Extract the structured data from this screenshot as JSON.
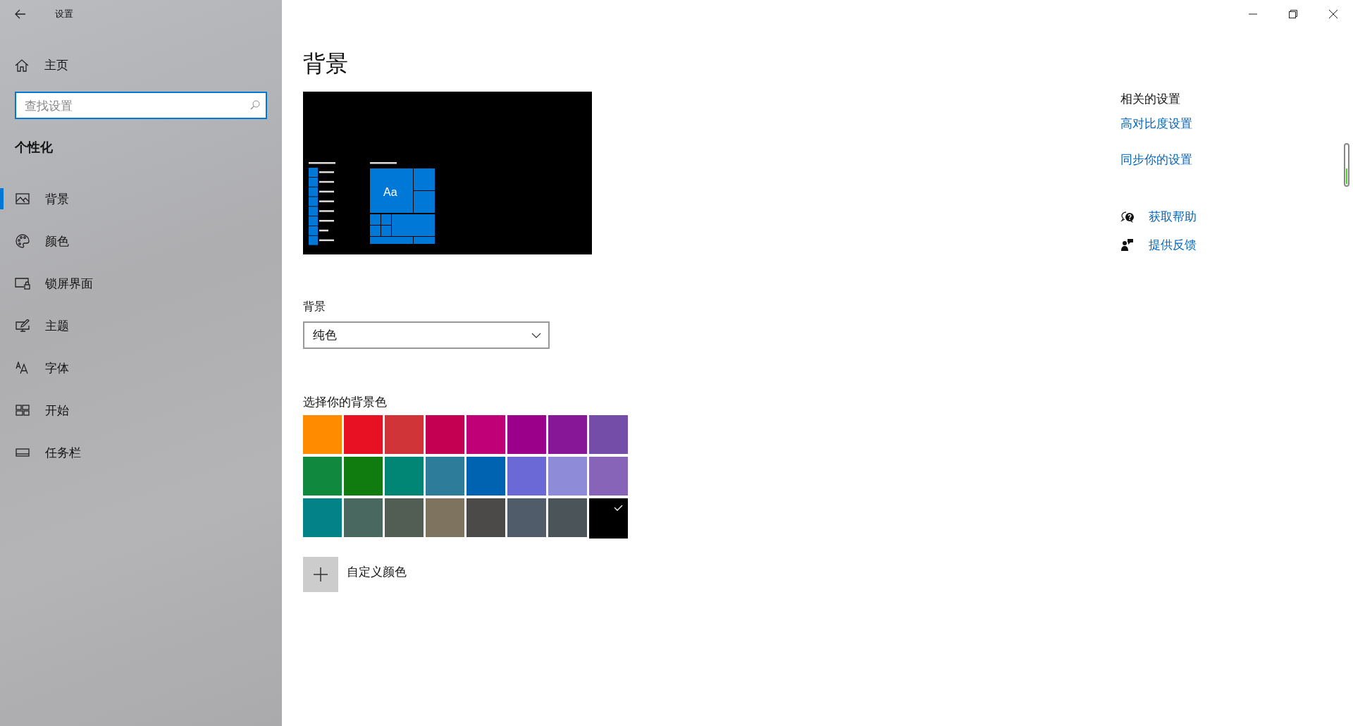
{
  "window": {
    "title": "设置"
  },
  "sidebar": {
    "home": "主页",
    "search": {
      "placeholder": "查找设置"
    },
    "section": "个性化",
    "items": [
      {
        "label": "背景",
        "kind": "picture",
        "selected": true
      },
      {
        "label": "颜色",
        "kind": "palette",
        "selected": false
      },
      {
        "label": "锁屏界面",
        "kind": "lock",
        "selected": false
      },
      {
        "label": "主题",
        "kind": "theme",
        "selected": false
      },
      {
        "label": "字体",
        "kind": "font",
        "selected": false
      },
      {
        "label": "开始",
        "kind": "start",
        "selected": false
      },
      {
        "label": "任务栏",
        "kind": "taskbar",
        "selected": false
      }
    ]
  },
  "page": {
    "title": "背景",
    "preview": {
      "tile_text": "Aa"
    },
    "background": {
      "label": "背景",
      "value": "纯色"
    },
    "colors_label": "选择你的背景色",
    "colors": [
      {
        "color": "#ff8c00",
        "selected": false
      },
      {
        "color": "#e81123",
        "selected": false
      },
      {
        "color": "#d13438",
        "selected": false
      },
      {
        "color": "#c30052",
        "selected": false
      },
      {
        "color": "#bf0077",
        "selected": false
      },
      {
        "color": "#9a0089",
        "selected": false
      },
      {
        "color": "#881798",
        "selected": false
      },
      {
        "color": "#744da9",
        "selected": false
      },
      {
        "color": "#10893e",
        "selected": false
      },
      {
        "color": "#107c10",
        "selected": false
      },
      {
        "color": "#018574",
        "selected": false
      },
      {
        "color": "#2d7d9a",
        "selected": false
      },
      {
        "color": "#0063b1",
        "selected": false
      },
      {
        "color": "#6b69d6",
        "selected": false
      },
      {
        "color": "#8e8cd8",
        "selected": false
      },
      {
        "color": "#8764b8",
        "selected": false
      },
      {
        "color": "#038387",
        "selected": false
      },
      {
        "color": "#486860",
        "selected": false
      },
      {
        "color": "#525e54",
        "selected": false
      },
      {
        "color": "#7e735f",
        "selected": false
      },
      {
        "color": "#4c4a48",
        "selected": false
      },
      {
        "color": "#515c6b",
        "selected": false
      },
      {
        "color": "#4a5459",
        "selected": false
      },
      {
        "color": "#000000",
        "selected": true
      }
    ],
    "custom_color": "自定义颜色"
  },
  "related": {
    "title": "相关的设置",
    "links": [
      "高对比度设置",
      "同步你的设置"
    ],
    "help": [
      {
        "label": "获取帮助",
        "kind": "help"
      },
      {
        "label": "提供反馈",
        "kind": "feedback"
      }
    ]
  }
}
